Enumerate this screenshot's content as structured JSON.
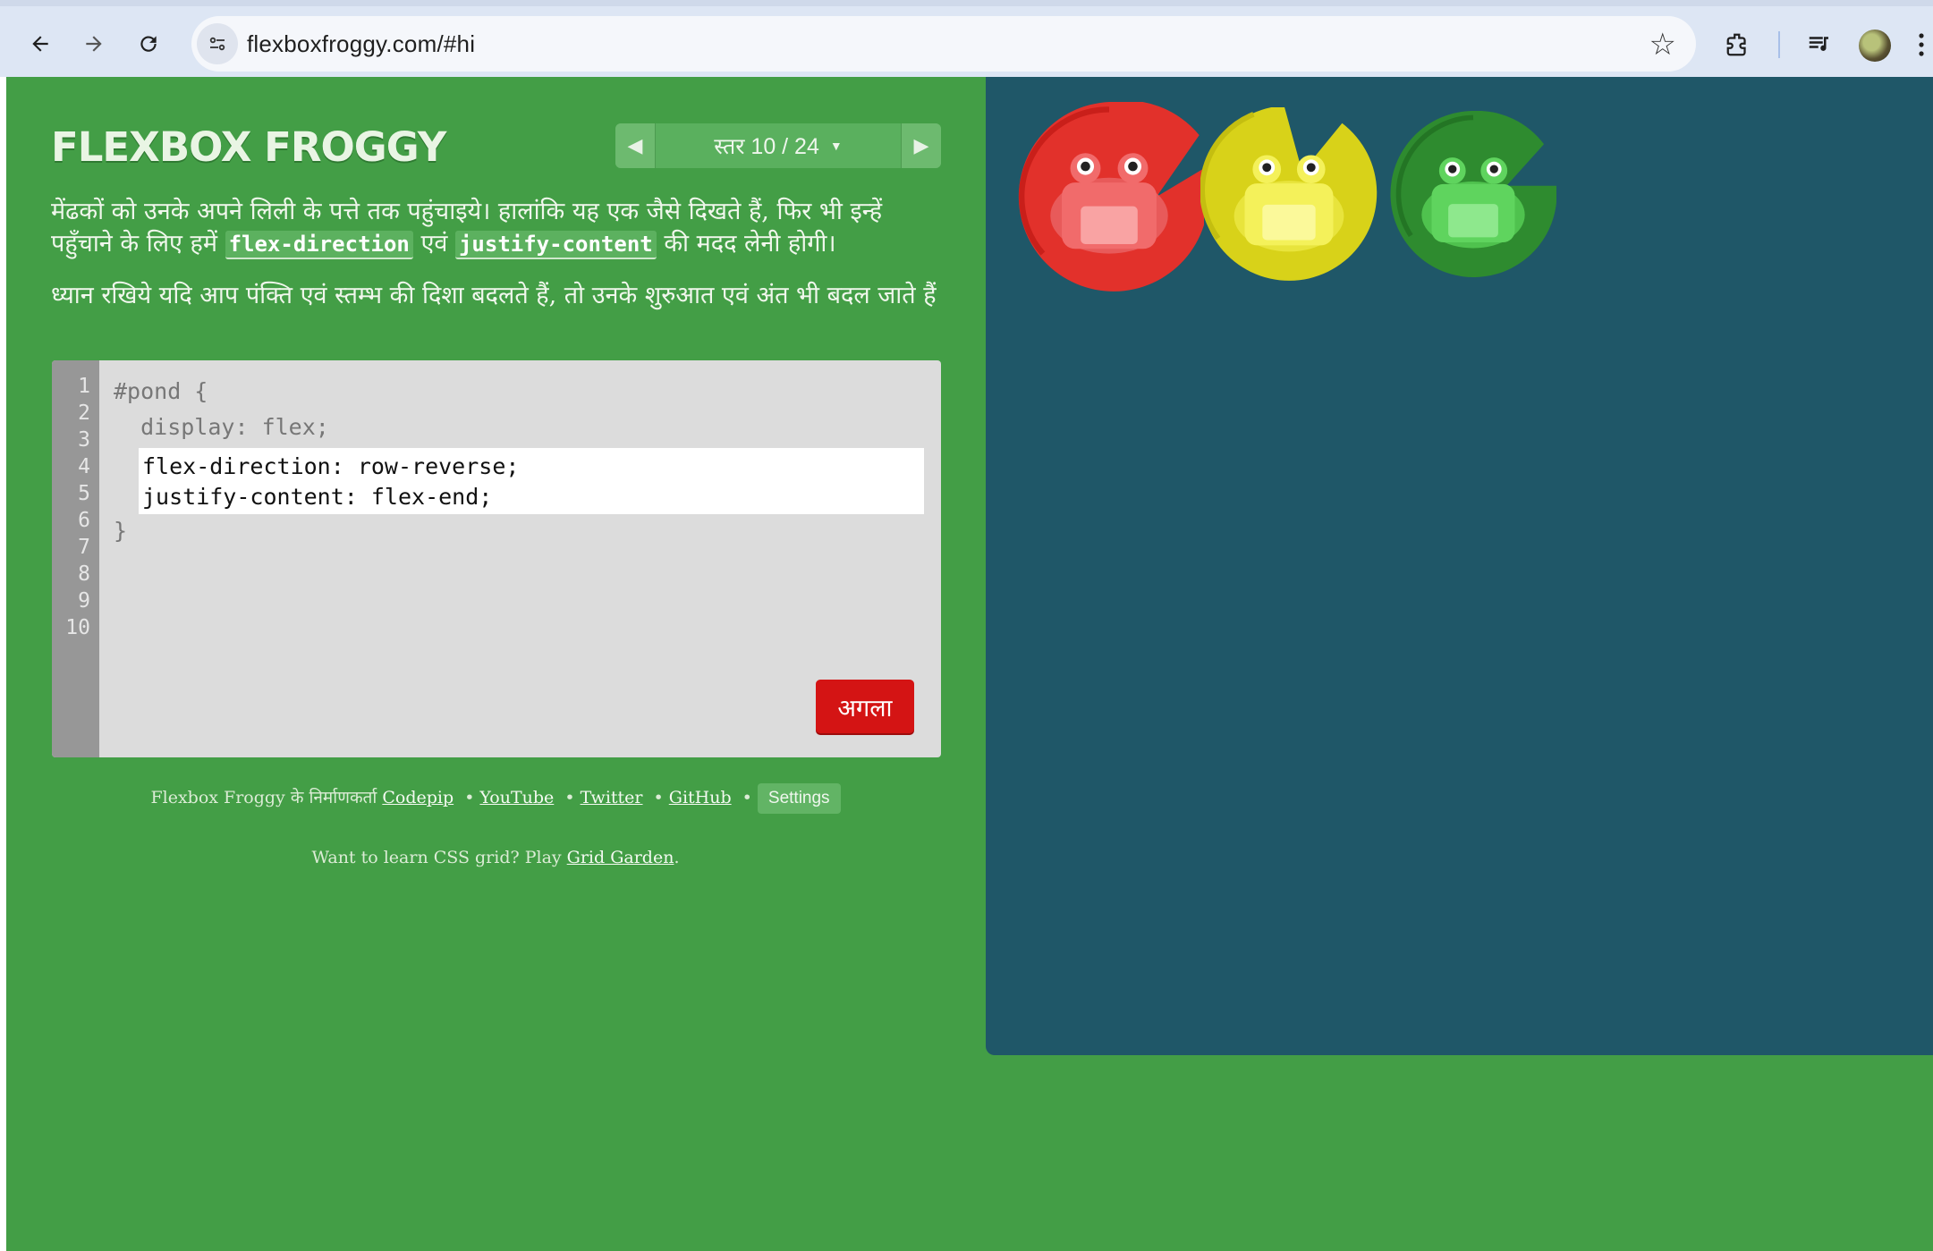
{
  "browser": {
    "url": "flexboxfroggy.com/#hi"
  },
  "header": {
    "logo": "FLEXBOX FROGGY",
    "level_text": "स्तर 10 / 24"
  },
  "instructions": {
    "p1_before": "मेंढकों को उनके अपने लिली के पत्ते तक पहुंचाइये। हालांकि यह एक जैसे दिखते हैं, फिर भी इन्हें पहुँचाने के लिए हमें ",
    "prop1": "flex-direction",
    "p1_mid": " एवं ",
    "prop2": "justify-content",
    "p1_after": " की मदद लेनी होगी।",
    "p2": "ध्यान रखिये यदि आप पंक्ति एवं स्तम्भ की दिशा बदलते हैं, तो उनके शुरुआत एवं अंत भी बदल जाते हैं"
  },
  "editor": {
    "line_numbers": [
      "1",
      "2",
      "3",
      "4",
      "5",
      "6",
      "7",
      "8",
      "9",
      "10"
    ],
    "line1": "#pond {",
    "line2": "  display: flex;",
    "input_line1": "flex-direction: row-reverse;",
    "input_line2": "justify-content: flex-end;",
    "line5": "}",
    "next_label": "अगला"
  },
  "credits": {
    "prefix": "Flexbox Froggy के निर्माणकर्ता",
    "codepip": "Codepip",
    "youtube": "YouTube",
    "twitter": "Twitter",
    "github": "GitHub",
    "bullet": "•",
    "settings": "Settings"
  },
  "grid_promo": {
    "text": "Want to learn CSS grid? Play ",
    "link": "Grid Garden",
    "suffix": "."
  },
  "pond": {
    "lilypads": [
      {
        "color": "red",
        "pad_hex": "#e2312b",
        "frog_hex": "#f16b6b"
      },
      {
        "color": "yellow",
        "pad_hex": "#d8d219",
        "frog_hex": "#f4f15a"
      },
      {
        "color": "green",
        "pad_hex": "#2e8b2f",
        "frog_hex": "#5fd45e"
      }
    ]
  },
  "colors": {
    "page_bg": "#439e46",
    "pond_bg": "#1f5768",
    "next_button": "#d41414"
  }
}
